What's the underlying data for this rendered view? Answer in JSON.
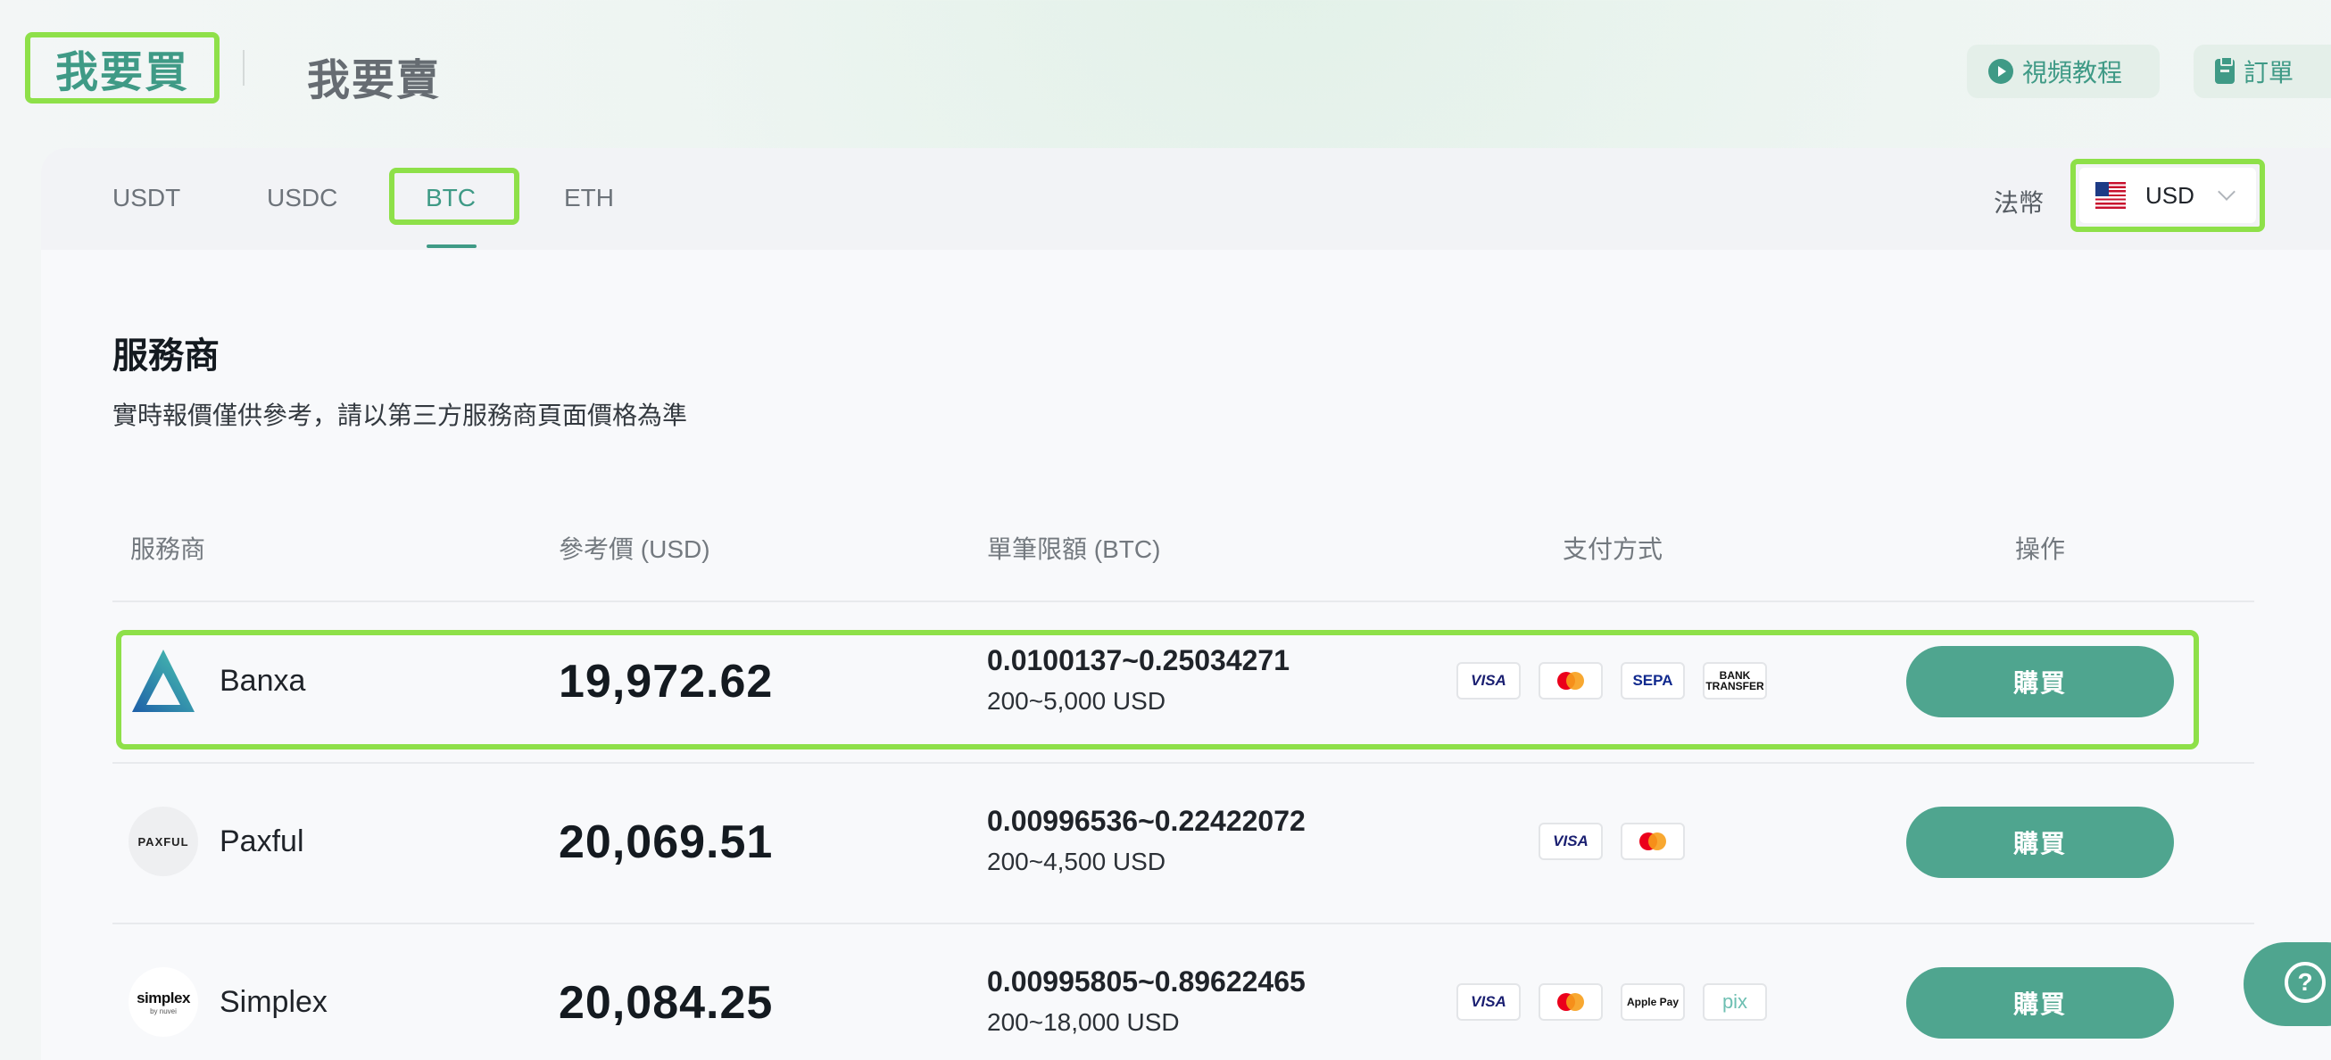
{
  "header": {
    "buy_tab": "我要買",
    "sell_tab": "我要賣",
    "video_tutorial": "視頻教程",
    "orders": "訂單"
  },
  "coin_tabs": [
    "USDT",
    "USDC",
    "BTC",
    "ETH"
  ],
  "active_coin": "BTC",
  "fiat": {
    "label": "法幣",
    "selected": "USD"
  },
  "section": {
    "title": "服務商",
    "subtitle": "實時報價僅供參考，請以第三方服務商頁面價格為準"
  },
  "table": {
    "headers": [
      "服務商",
      "參考價 (USD)",
      "單筆限額 (BTC)",
      "支付方式",
      "操作"
    ],
    "rows": [
      {
        "provider": "Banxa",
        "price": "19,972.62",
        "limit_btc": "0.0100137~0.25034271",
        "limit_usd": "200~5,000 USD",
        "payments": [
          "VISA",
          "mastercard",
          "SEPA",
          "BANK TRANSFER"
        ],
        "action": "購買"
      },
      {
        "provider": "Paxful",
        "logo_text": "PAXFUL",
        "price": "20,069.51",
        "limit_btc": "0.00996536~0.22422072",
        "limit_usd": "200~4,500 USD",
        "payments": [
          "VISA",
          "mastercard"
        ],
        "action": "購買"
      },
      {
        "provider": "Simplex",
        "logo_text": "simplex",
        "logo_sub": "by nuvei",
        "price": "20,084.25",
        "limit_btc": "0.00995805~0.89622465",
        "limit_usd": "200~18,000 USD",
        "payments": [
          "VISA",
          "mastercard",
          "Apple Pay",
          "pix"
        ],
        "action": "購買"
      }
    ]
  },
  "help_icon": "?",
  "colors": {
    "accent": "#4fa58f",
    "highlight": "#8ee049"
  }
}
